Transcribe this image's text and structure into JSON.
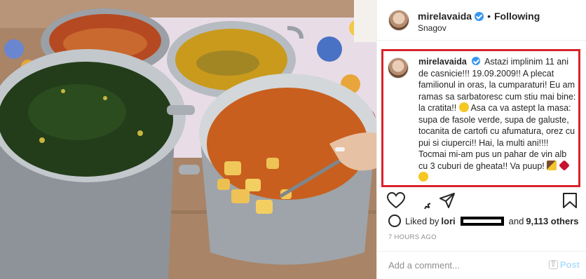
{
  "colors": {
    "highlight_border": "#d9232a",
    "verified_blue": "#3897f0",
    "muted_text": "#8e8e8e",
    "post_link": "#b2dffc"
  },
  "photo": {
    "icon": "food-photo"
  },
  "header": {
    "username": "mirelavaida",
    "separator": "•",
    "following_label": "Following",
    "location": "Snagov"
  },
  "caption": {
    "username": "mirelavaida",
    "text_part1": "Astazi implinim 11 ani de casnicie!!! 19.09.2009!! A plecat familionul in oras, la cumparaturi! Eu am ramas sa sarbatoresc cum stiu mai bine: la cratita!!",
    "text_part2": "Asa ca va astept la masa: supa de fasole verde, supa de galuste, tocanita de cartofi cu afumatura, orez cu pui si ciuperci!! Hai, la multi ani!!!! Tocmai mi-am pus un pahar de vin alb cu 3 cuburi de gheata!! Va puup!",
    "emoji_icons": [
      "grinning-face-icon",
      "party-popper-icon",
      "broken-heart-icon",
      "kissing-face-icon"
    ]
  },
  "actions": {
    "icons": [
      "heart-icon",
      "comment-icon",
      "share-icon",
      "bookmark-icon"
    ]
  },
  "likes": {
    "prefix": "Liked by",
    "first_user": "lori",
    "middle": "and",
    "count_text": "9,113 others"
  },
  "timestamp": "7 HOURS AGO",
  "comment": {
    "placeholder": "Add a comment...",
    "post_label": "Post"
  }
}
